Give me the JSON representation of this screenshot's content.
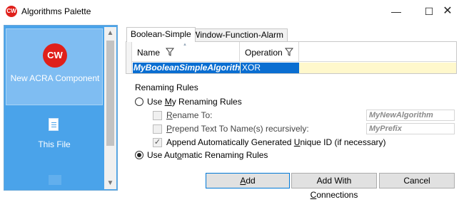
{
  "window": {
    "app_logo": "CW",
    "title": "Algorithms Palette",
    "minimize_glyph": "—",
    "maximize_glyph": "☐",
    "close_glyph": "✕"
  },
  "sidebar": {
    "items": [
      {
        "label": "New ACRA Component",
        "icon": "cw-logo-icon",
        "logo_text": "CW",
        "selected": true
      },
      {
        "label": "This File",
        "icon": "file-icon",
        "selected": false
      }
    ]
  },
  "tabs": [
    {
      "label": "Boolean-Simple",
      "active": true
    },
    {
      "label": "Window-Function-Alarm",
      "active": false
    }
  ],
  "grid": {
    "columns": [
      "Name",
      "Operation"
    ],
    "rows": [
      {
        "name": "MyBooleanSimpleAlgorithm",
        "operation": "XOR"
      }
    ]
  },
  "renaming": {
    "group_label": "Renaming Rules",
    "use_my_rules": {
      "pre": "Use ",
      "accel": "M",
      "post": "y Renaming Rules",
      "checked": false
    },
    "rename_to": {
      "accel": "R",
      "post": "ename To:",
      "value": "MyNewAlgorithm",
      "checked": false
    },
    "prepend": {
      "accel": "P",
      "post": "repend Text To Name(s) recursively:",
      "value": "MyPrefix",
      "checked": false
    },
    "append": {
      "pre": "Append Automatically Generated ",
      "accel": "U",
      "post": "nique ID (if necessary)",
      "checked": true
    },
    "use_auto_rules": {
      "pre": "Use Aut",
      "accel": "o",
      "post": "matic Renaming Rules",
      "checked": true
    }
  },
  "buttons": {
    "add": {
      "accel": "A",
      "post": "dd"
    },
    "add_with_connections": {
      "pre": "Add With ",
      "accel": "C",
      "post": "onnections"
    },
    "cancel": "Cancel"
  },
  "colors": {
    "sidebar": "#4aa3ea",
    "selection": "#0a6ed1",
    "row_highlight": "#fff8cc",
    "brand_red": "#e0201b"
  }
}
